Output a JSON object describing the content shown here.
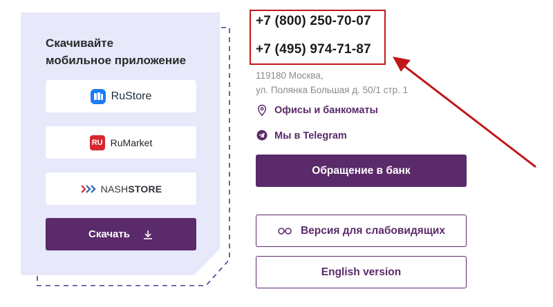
{
  "app_section": {
    "title_line1": "Скачивайте",
    "title_line2": "мобильное приложение",
    "stores": [
      {
        "name": "RuStore",
        "icon": "rustore-icon"
      },
      {
        "name": "RuMarket",
        "icon": "rumarket-icon",
        "logo_text": "RU"
      },
      {
        "name_prefix": "NASH",
        "name_suffix": "STORE",
        "icon": "nashstore-icon"
      }
    ],
    "download_label": "Скачать",
    "download_icon": "download-icon"
  },
  "contacts": {
    "phones": [
      "+7 (800) 250-70-07",
      "+7 (495) 974-71-87"
    ],
    "address_line1": "119180 Москва,",
    "address_line2": "ул. Полянка Большая д. 50/1 стр. 1",
    "offices_label": "Офисы и банкоматы",
    "offices_icon": "location-pin-icon",
    "telegram_label": "Мы в Telegram",
    "telegram_icon": "telegram-icon"
  },
  "buttons": {
    "contact_bank": "Обращение в банк",
    "accessibility": "Версия для слабовидящих",
    "accessibility_icon": "glasses-icon",
    "english": "English version"
  },
  "colors": {
    "brand_purple": "#5a2a6a",
    "card_bg": "#e7e8fa",
    "highlight_red": "#c0171a"
  }
}
